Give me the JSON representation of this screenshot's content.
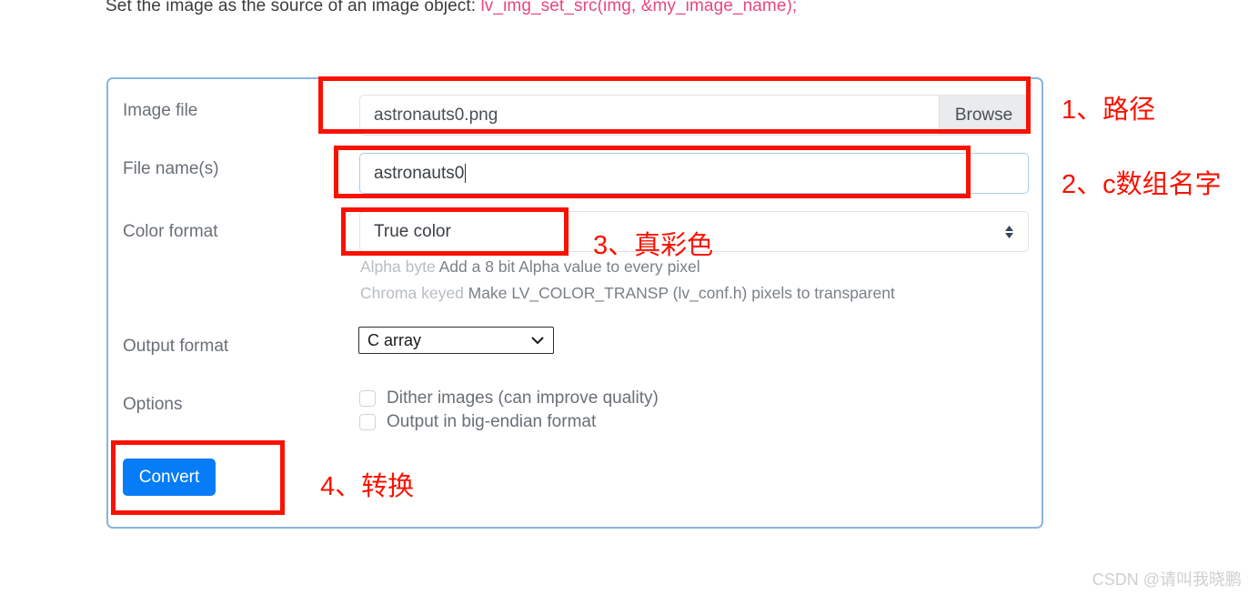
{
  "intro": {
    "text": "Set the image as the source of an image object: ",
    "code": "lv_img_set_src(img, &my_image_name);"
  },
  "form": {
    "rows": {
      "image_file": {
        "label": "Image file",
        "value": "astronauts0.png",
        "browse_label": "Browse"
      },
      "file_names": {
        "label": "File name(s)",
        "value": "astronauts0"
      },
      "color_format": {
        "label": "Color format",
        "value": "True color",
        "hint_1_lead": "Alpha byte",
        "hint_1_rest": " Add a 8 bit Alpha value to every pixel",
        "hint_2_lead": "Chroma keyed",
        "hint_2_rest": " Make LV_COLOR_TRANSP (lv_conf.h) pixels to transparent"
      },
      "output_format": {
        "label": "Output format",
        "value": "C array"
      },
      "options": {
        "label": "Options",
        "dither_label": "Dither images (can improve quality)",
        "big_endian_label": "Output in big-endian format"
      }
    },
    "convert_label": "Convert"
  },
  "annotations": {
    "one": "1、路径",
    "two": "2、c数组名字",
    "three": "3、真彩色",
    "four": "4、转换"
  },
  "watermark": "CSDN @请叫我晓鹏",
  "colors": {
    "annotation_red": "#fb1100",
    "primary_blue": "#067cf7",
    "panel_border": "#8ab4de",
    "code_pink": "#e8477f"
  }
}
